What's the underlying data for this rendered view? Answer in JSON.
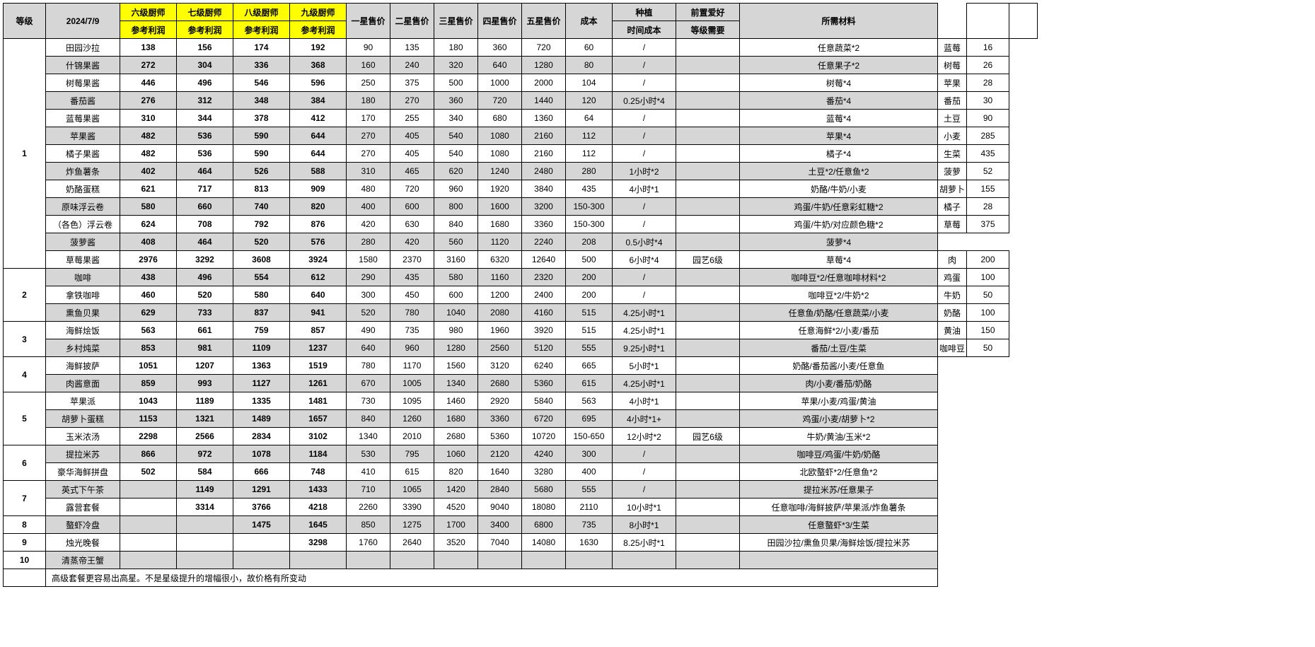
{
  "headers": {
    "level": "等级",
    "date": "2024/7/9",
    "p6a": "六级厨师",
    "p6b": "参考利润",
    "p7a": "七级厨师",
    "p7b": "参考利润",
    "p8a": "八级厨师",
    "p8b": "参考利润",
    "p9a": "九级厨师",
    "p9b": "参考利润",
    "s1": "一星售价",
    "s2": "二星售价",
    "s3": "三星售价",
    "s4": "四星售价",
    "s5": "五星售价",
    "cost": "成本",
    "plant_a": "种植",
    "plant_b": "时间成本",
    "req_a": "前置爱好",
    "req_b": "等级需要",
    "mat": "所需材料"
  },
  "levels": {
    "1": "1",
    "2": "2",
    "3": "3",
    "4": "4",
    "5": "5",
    "6": "6",
    "7": "7",
    "8": "8",
    "9": "9",
    "10": "10"
  },
  "rows": [
    {
      "name": "田园沙拉",
      "p6": "138",
      "p7": "156",
      "p8": "174",
      "p9": "192",
      "s1": "90",
      "s2": "135",
      "s3": "180",
      "s4": "360",
      "s5": "720",
      "cost": "60",
      "plant": "/",
      "req": "",
      "mat": "任意蔬菜*2",
      "shade": false
    },
    {
      "name": "什锦果酱",
      "p6": "272",
      "p7": "304",
      "p8": "336",
      "p9": "368",
      "s1": "160",
      "s2": "240",
      "s3": "320",
      "s4": "640",
      "s5": "1280",
      "cost": "80",
      "plant": "/",
      "req": "",
      "mat": "任意果子*2",
      "shade": true
    },
    {
      "name": "树莓果酱",
      "p6": "446",
      "p7": "496",
      "p8": "546",
      "p9": "596",
      "s1": "250",
      "s2": "375",
      "s3": "500",
      "s4": "1000",
      "s5": "2000",
      "cost": "104",
      "plant": "/",
      "req": "",
      "mat": "树莓*4",
      "shade": false
    },
    {
      "name": "番茄酱",
      "p6": "276",
      "p7": "312",
      "p8": "348",
      "p9": "384",
      "s1": "180",
      "s2": "270",
      "s3": "360",
      "s4": "720",
      "s5": "1440",
      "cost": "120",
      "plant": "0.25小时*4",
      "req": "",
      "mat": "番茄*4",
      "shade": true
    },
    {
      "name": "蓝莓果酱",
      "p6": "310",
      "p7": "344",
      "p8": "378",
      "p9": "412",
      "s1": "170",
      "s2": "255",
      "s3": "340",
      "s4": "680",
      "s5": "1360",
      "cost": "64",
      "plant": "/",
      "req": "",
      "mat": "蓝莓*4",
      "shade": false
    },
    {
      "name": "苹果酱",
      "p6": "482",
      "p7": "536",
      "p8": "590",
      "p9": "644",
      "s1": "270",
      "s2": "405",
      "s3": "540",
      "s4": "1080",
      "s5": "2160",
      "cost": "112",
      "plant": "/",
      "req": "",
      "mat": "苹果*4",
      "shade": true
    },
    {
      "name": "橘子果酱",
      "p6": "482",
      "p7": "536",
      "p8": "590",
      "p9": "644",
      "s1": "270",
      "s2": "405",
      "s3": "540",
      "s4": "1080",
      "s5": "2160",
      "cost": "112",
      "plant": "/",
      "req": "",
      "mat": "橘子*4",
      "shade": false
    },
    {
      "name": "炸鱼薯条",
      "p6": "402",
      "p7": "464",
      "p8": "526",
      "p9": "588",
      "s1": "310",
      "s2": "465",
      "s3": "620",
      "s4": "1240",
      "s5": "2480",
      "cost": "280",
      "plant": "1小时*2",
      "req": "",
      "mat": "土豆*2/任意鱼*2",
      "shade": true
    },
    {
      "name": "奶酪蛋糕",
      "p6": "621",
      "p7": "717",
      "p8": "813",
      "p9": "909",
      "s1": "480",
      "s2": "720",
      "s3": "960",
      "s4": "1920",
      "s5": "3840",
      "cost": "435",
      "plant": "4小时*1",
      "req": "",
      "mat": "奶酪/牛奶/小麦",
      "shade": false
    },
    {
      "name": "原味浮云卷",
      "p6": "580",
      "p7": "660",
      "p8": "740",
      "p9": "820",
      "s1": "400",
      "s2": "600",
      "s3": "800",
      "s4": "1600",
      "s5": "3200",
      "cost": "150-300",
      "plant": "/",
      "req": "",
      "mat": "鸡蛋/牛奶/任意彩虹糖*2",
      "shade": true
    },
    {
      "name": "（各色）浮云卷",
      "p6": "624",
      "p7": "708",
      "p8": "792",
      "p9": "876",
      "s1": "420",
      "s2": "630",
      "s3": "840",
      "s4": "1680",
      "s5": "3360",
      "cost": "150-300",
      "plant": "/",
      "req": "",
      "mat": "鸡蛋/牛奶/对应颜色糖*2",
      "shade": false
    },
    {
      "name": "菠萝酱",
      "p6": "408",
      "p7": "464",
      "p8": "520",
      "p9": "576",
      "s1": "280",
      "s2": "420",
      "s3": "560",
      "s4": "1120",
      "s5": "2240",
      "cost": "208",
      "plant": "0.5小时*4",
      "req": "",
      "mat": "菠萝*4",
      "shade": true
    },
    {
      "name": "草莓果酱",
      "p6": "2976",
      "p7": "3292",
      "p8": "3608",
      "p9": "3924",
      "s1": "1580",
      "s2": "2370",
      "s3": "3160",
      "s4": "6320",
      "s5": "12640",
      "cost": "500",
      "plant": "6小时*4",
      "req": "园艺6级",
      "mat": "草莓*4",
      "shade": false
    },
    {
      "name": "咖啡",
      "p6": "438",
      "p7": "496",
      "p8": "554",
      "p9": "612",
      "s1": "290",
      "s2": "435",
      "s3": "580",
      "s4": "1160",
      "s5": "2320",
      "cost": "200",
      "plant": "/",
      "req": "",
      "mat": "咖啡豆*2/任意咖啡材料*2",
      "shade": true
    },
    {
      "name": "拿铁咖啡",
      "p6": "460",
      "p7": "520",
      "p8": "580",
      "p9": "640",
      "s1": "300",
      "s2": "450",
      "s3": "600",
      "s4": "1200",
      "s5": "2400",
      "cost": "200",
      "plant": "/",
      "req": "",
      "mat": "咖啡豆*2/牛奶*2",
      "shade": false
    },
    {
      "name": "熏鱼贝果",
      "p6": "629",
      "p7": "733",
      "p8": "837",
      "p9": "941",
      "s1": "520",
      "s2": "780",
      "s3": "1040",
      "s4": "2080",
      "s5": "4160",
      "cost": "515",
      "plant": "4.25小时*1",
      "req": "",
      "mat": "任意鱼/奶酪/任意蔬菜/小麦",
      "shade": true
    },
    {
      "name": "海鲜烩饭",
      "p6": "563",
      "p7": "661",
      "p8": "759",
      "p9": "857",
      "s1": "490",
      "s2": "735",
      "s3": "980",
      "s4": "1960",
      "s5": "3920",
      "cost": "515",
      "plant": "4.25小时*1",
      "req": "",
      "mat": "任意海鲜*2/小麦/番茄",
      "shade": false
    },
    {
      "name": "乡村炖菜",
      "p6": "853",
      "p7": "981",
      "p8": "1109",
      "p9": "1237",
      "s1": "640",
      "s2": "960",
      "s3": "1280",
      "s4": "2560",
      "s5": "5120",
      "cost": "555",
      "plant": "9.25小时*1",
      "req": "",
      "mat": "番茄/土豆/生菜",
      "shade": true
    },
    {
      "name": "海鲜披萨",
      "p6": "1051",
      "p7": "1207",
      "p8": "1363",
      "p9": "1519",
      "s1": "780",
      "s2": "1170",
      "s3": "1560",
      "s4": "3120",
      "s5": "6240",
      "cost": "665",
      "plant": "5小时*1",
      "req": "",
      "mat": "奶酪/番茄酱/小麦/任意鱼",
      "shade": false
    },
    {
      "name": "肉酱意面",
      "p6": "859",
      "p7": "993",
      "p8": "1127",
      "p9": "1261",
      "s1": "670",
      "s2": "1005",
      "s3": "1340",
      "s4": "2680",
      "s5": "5360",
      "cost": "615",
      "plant": "4.25小时*1",
      "req": "",
      "mat": "肉/小麦/番茄/奶酪",
      "shade": true
    },
    {
      "name": "苹果派",
      "p6": "1043",
      "p7": "1189",
      "p8": "1335",
      "p9": "1481",
      "s1": "730",
      "s2": "1095",
      "s3": "1460",
      "s4": "2920",
      "s5": "5840",
      "cost": "563",
      "plant": "4小时*1",
      "req": "",
      "mat": "苹果/小麦/鸡蛋/黄油",
      "shade": false
    },
    {
      "name": "胡萝卜蛋糕",
      "p6": "1153",
      "p7": "1321",
      "p8": "1489",
      "p9": "1657",
      "s1": "840",
      "s2": "1260",
      "s3": "1680",
      "s4": "3360",
      "s5": "6720",
      "cost": "695",
      "plant": "4小时*1+",
      "req": "",
      "mat": "鸡蛋/小麦/胡萝卜*2",
      "shade": true
    },
    {
      "name": "玉米浓汤",
      "p6": "2298",
      "p7": "2566",
      "p8": "2834",
      "p9": "3102",
      "s1": "1340",
      "s2": "2010",
      "s3": "2680",
      "s4": "5360",
      "s5": "10720",
      "cost": "150-650",
      "plant": "12小时*2",
      "req": "园艺6级",
      "mat": "牛奶/黄油/玉米*2",
      "shade": false
    },
    {
      "name": "提拉米苏",
      "p6": "866",
      "p7": "972",
      "p8": "1078",
      "p9": "1184",
      "s1": "530",
      "s2": "795",
      "s3": "1060",
      "s4": "2120",
      "s5": "4240",
      "cost": "300",
      "plant": "/",
      "req": "",
      "mat": "咖啡豆/鸡蛋/牛奶/奶酪",
      "shade": true
    },
    {
      "name": "豪华海鲜拼盘",
      "p6": "502",
      "p7": "584",
      "p8": "666",
      "p9": "748",
      "s1": "410",
      "s2": "615",
      "s3": "820",
      "s4": "1640",
      "s5": "3280",
      "cost": "400",
      "plant": "/",
      "req": "",
      "mat": "北欧螯虾*2/任意鱼*2",
      "shade": false
    },
    {
      "name": "英式下午茶",
      "p6": "",
      "p7": "1149",
      "p8": "1291",
      "p9": "1433",
      "s1": "710",
      "s2": "1065",
      "s3": "1420",
      "s4": "2840",
      "s5": "5680",
      "cost": "555",
      "plant": "/",
      "req": "",
      "mat": "提拉米苏/任意果子",
      "shade": true
    },
    {
      "name": "露营套餐",
      "p6": "",
      "p7": "3314",
      "p8": "3766",
      "p9": "4218",
      "s1": "2260",
      "s2": "3390",
      "s3": "4520",
      "s4": "9040",
      "s5": "18080",
      "cost": "2110",
      "plant": "10小时*1",
      "req": "",
      "mat": "任意咖啡/海鲜披萨/苹果派/炸鱼薯条",
      "shade": false
    },
    {
      "name": "螯虾冷盘",
      "p6": "",
      "p7": "",
      "p8": "1475",
      "p9": "1645",
      "s1": "850",
      "s2": "1275",
      "s3": "1700",
      "s4": "3400",
      "s5": "6800",
      "cost": "735",
      "plant": "8小时*1",
      "req": "",
      "mat": "任意螯虾*3/生菜",
      "shade": true
    },
    {
      "name": "烛光晚餐",
      "p6": "",
      "p7": "",
      "p8": "",
      "p9": "3298",
      "s1": "1760",
      "s2": "2640",
      "s3": "3520",
      "s4": "7040",
      "s5": "14080",
      "cost": "1630",
      "plant": "8.25小时*1",
      "req": "",
      "mat": "田园沙拉/熏鱼贝果/海鲜烩饭/提拉米苏",
      "shade": false
    },
    {
      "name": "清蒸帝王蟹",
      "p6": "",
      "p7": "",
      "p8": "",
      "p9": "",
      "s1": "",
      "s2": "",
      "s3": "",
      "s4": "",
      "s5": "",
      "cost": "",
      "plant": "",
      "req": "",
      "mat": "",
      "shade": true
    }
  ],
  "side": [
    {
      "name": "蓝莓",
      "val": "16"
    },
    {
      "name": "树莓",
      "val": "26"
    },
    {
      "name": "苹果",
      "val": "28"
    },
    {
      "name": "番茄",
      "val": "30"
    },
    {
      "name": "土豆",
      "val": "90"
    },
    {
      "name": "小麦",
      "val": "285"
    },
    {
      "name": "生菜",
      "val": "435"
    },
    {
      "name": "菠萝",
      "val": "52"
    },
    {
      "name": "胡萝卜",
      "val": "155"
    },
    {
      "name": "橘子",
      "val": "28"
    },
    {
      "name": "草莓",
      "val": "375"
    },
    {
      "name": "",
      "val": ""
    },
    {
      "name": "肉",
      "val": "200"
    },
    {
      "name": "鸡蛋",
      "val": "100"
    },
    {
      "name": "牛奶",
      "val": "50"
    },
    {
      "name": "奶酪",
      "val": "100"
    },
    {
      "name": "黄油",
      "val": "150"
    },
    {
      "name": "咖啡豆",
      "val": "50"
    }
  ],
  "note": "高级套餐更容易出高星。不是星级提升的增幅很小，故价格有所变动"
}
